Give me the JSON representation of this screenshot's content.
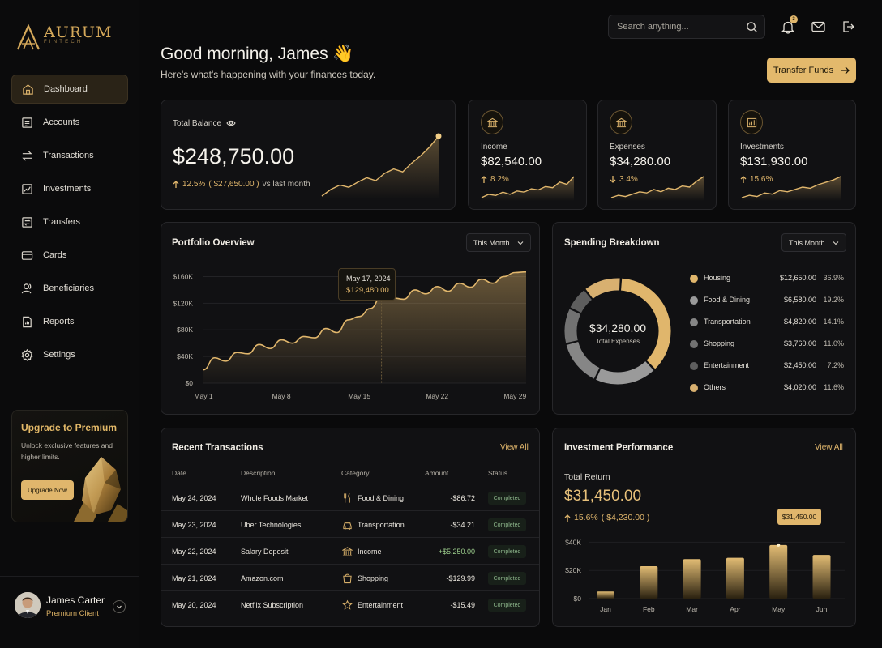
{
  "brand": {
    "name": "AURUM",
    "sub": "FINTECH"
  },
  "nav": [
    {
      "label": "Dashboard",
      "icon": "dashboard-icon",
      "active": true
    },
    {
      "label": "Accounts",
      "icon": "accounts-icon"
    },
    {
      "label": "Transactions",
      "icon": "transactions-icon"
    },
    {
      "label": "Investments",
      "icon": "investments-icon"
    },
    {
      "label": "Transfers",
      "icon": "transfers-icon"
    },
    {
      "label": "Cards",
      "icon": "card-icon"
    },
    {
      "label": "Beneficiaries",
      "icon": "beneficiaries-icon"
    },
    {
      "label": "Reports",
      "icon": "reports-icon"
    },
    {
      "label": "Settings",
      "icon": "settings-icon"
    }
  ],
  "upgrade": {
    "title": "Upgrade to Premium",
    "text": "Unlock exclusive features and higher limits.",
    "button": "Upgrade Now"
  },
  "user": {
    "name": "James Carter",
    "role": "Premium Client"
  },
  "topbar": {
    "search_placeholder": "Search anything...",
    "notification_count": "3"
  },
  "header": {
    "greeting": "Good morning, James 👋",
    "subtitle": "Here's what's happening with your finances today.",
    "transfer_button": "Transfer Funds"
  },
  "balance": {
    "label": "Total Balance",
    "amount": "$248,750.00",
    "change_pct": "12.5%",
    "change_amt": "( $27,650.00 )",
    "change_suffix": "vs last month",
    "trend": [
      3,
      12,
      18,
      15,
      22,
      28,
      24,
      34,
      40,
      36,
      48,
      58,
      70,
      85
    ]
  },
  "stats": [
    {
      "label": "Income",
      "value": "$82,540.00",
      "change": "8.2%",
      "direction": "up",
      "icon": "income-icon",
      "trend": [
        3,
        6,
        5,
        8,
        6,
        9,
        8,
        11,
        10,
        13,
        12,
        17,
        15,
        22
      ]
    },
    {
      "label": "Expenses",
      "value": "$34,280.00",
      "change": "3.4%",
      "direction": "down",
      "icon": "expenses-icon",
      "trend": [
        4,
        6,
        5,
        7,
        9,
        8,
        11,
        9,
        12,
        11,
        14,
        13,
        18,
        22
      ]
    },
    {
      "label": "Investments",
      "value": "$131,930.00",
      "change": "15.6%",
      "direction": "up",
      "icon": "investments-chart-icon",
      "trend": [
        3,
        5,
        4,
        7,
        6,
        9,
        8,
        10,
        12,
        11,
        14,
        16,
        18,
        21
      ]
    }
  ],
  "portfolio": {
    "title": "Portfolio Overview",
    "range": "This Month",
    "tooltip_date": "May 17, 2024",
    "tooltip_value": "$129,480.00"
  },
  "spending": {
    "title": "Spending Breakdown",
    "range": "This Month",
    "total": "$34,280.00",
    "total_label": "Total Expenses"
  },
  "transactions": {
    "title": "Recent Transactions",
    "view_all": "View All",
    "headers": [
      "Date",
      "Description",
      "Category",
      "Amount",
      "Status"
    ],
    "rows": [
      {
        "date": "May 24, 2024",
        "desc": "Whole Foods Market",
        "cat": "Food & Dining",
        "amount": "-$86.72",
        "status": "Completed",
        "icon": "food-icon"
      },
      {
        "date": "May 23, 2024",
        "desc": "Uber Technologies",
        "cat": "Transportation",
        "amount": "-$34.21",
        "status": "Completed",
        "icon": "car-icon"
      },
      {
        "date": "May 22, 2024",
        "desc": "Salary Deposit",
        "cat": "Income",
        "amount": "+$5,250.00",
        "status": "Completed",
        "icon": "income-icon"
      },
      {
        "date": "May 21, 2024",
        "desc": "Amazon.com",
        "cat": "Shopping",
        "amount": "-$129.99",
        "status": "Completed",
        "icon": "shopping-icon"
      },
      {
        "date": "May 20, 2024",
        "desc": "Netflix Subscription",
        "cat": "Entertainment",
        "amount": "-$15.49",
        "status": "Completed",
        "icon": "entertainment-icon"
      }
    ]
  },
  "investment": {
    "title": "Investment Performance",
    "view_all": "View All",
    "total_label": "Total Return",
    "total": "$31,450.00",
    "change_pct": "15.6%",
    "change_amt": "( $4,230.00 )",
    "tooltip": "$31,450.00"
  },
  "chart_data": [
    {
      "type": "area",
      "x": [
        "May 1",
        "May 2",
        "May 3",
        "May 4",
        "May 5",
        "May 6",
        "May 7",
        "May 8",
        "May 9",
        "May 10",
        "May 11",
        "May 12",
        "May 13",
        "May 14",
        "May 15",
        "May 16",
        "May 17",
        "May 18",
        "May 19",
        "May 20",
        "May 21",
        "May 22",
        "May 23",
        "May 24",
        "May 25",
        "May 26",
        "May 27",
        "May 28",
        "May 29",
        "May 30"
      ],
      "xticks": [
        "May 1",
        "May 8",
        "May 15",
        "May 22",
        "May 29"
      ],
      "series": [
        {
          "values": [
            20000,
            38000,
            33000,
            46000,
            44000,
            58000,
            52000,
            65000,
            60000,
            70000,
            68000,
            82000,
            76000,
            95000,
            100000,
            112000,
            129480,
            128000,
            126000,
            140000,
            134000,
            145000,
            138000,
            150000,
            144000,
            156000,
            150000,
            160000,
            166000,
            167000
          ]
        }
      ],
      "yticks": [
        "$0",
        "$40K",
        "$80K",
        "$120K",
        "$160K"
      ],
      "ylim": [
        0,
        180000
      ]
    },
    {
      "type": "pie",
      "categories": [
        "Housing",
        "Food & Dining",
        "Transportation",
        "Shopping",
        "Entertainment",
        "Others"
      ],
      "amounts": [
        "$12,650.00",
        "$6,580.00",
        "$4,820.00",
        "$3,760.00",
        "$2,450.00",
        "$4,020.00"
      ],
      "percents": [
        "36.9%",
        "19.2%",
        "14.1%",
        "11.0%",
        "7.2%",
        "11.6%"
      ],
      "values": [
        36.9,
        19.2,
        14.1,
        11.0,
        7.2,
        11.6
      ],
      "colors": [
        "#e0b66c",
        "#9a9a9a",
        "#868686",
        "#727272",
        "#5e5e5e",
        "#d8b070"
      ]
    },
    {
      "type": "bar",
      "categories": [
        "Jan",
        "Feb",
        "Mar",
        "Apr",
        "May",
        "Jun"
      ],
      "values": [
        5000,
        23000,
        28000,
        29000,
        38000,
        31000
      ],
      "yticks": [
        "$0",
        "$20K",
        "$40K"
      ],
      "ylim": [
        0,
        46000
      ]
    }
  ]
}
